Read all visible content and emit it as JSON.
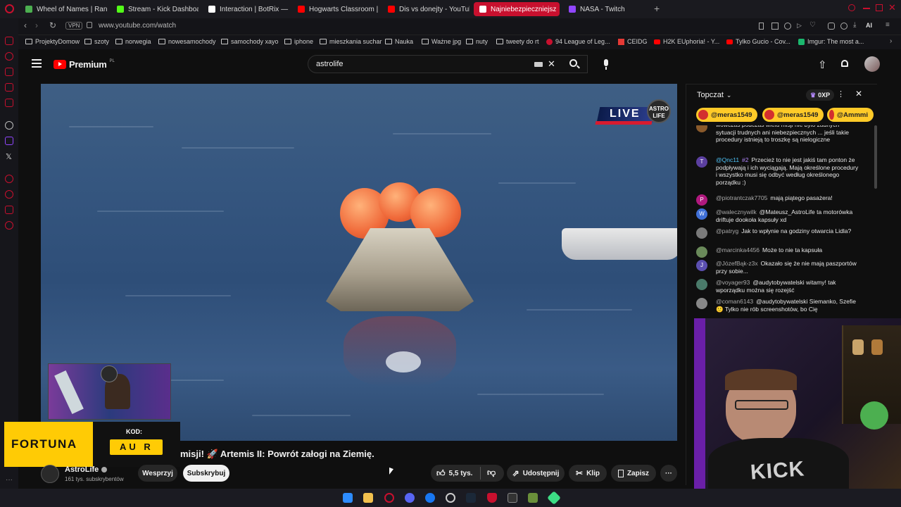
{
  "browser": {
    "tabs": [
      {
        "label": "Wheel of Names | Random",
        "color": "#4caf50",
        "active": false
      },
      {
        "label": "Stream - Kick Dashboard",
        "color": "#53fc18",
        "active": false
      },
      {
        "label": "Interaction | BotRix — Clo",
        "color": "#ffffff",
        "active": false
      },
      {
        "label": "Hogwarts Classroom | Ha",
        "color": "#ff0000",
        "active": false
      },
      {
        "label": "Dis vs donejty - YouTube",
        "color": "#ff0000",
        "active": false
      },
      {
        "label": "Najniebezpieczniejsz",
        "color": "#ffffff",
        "active": true
      },
      {
        "label": "NASA - Twitch",
        "color": "#9146ff",
        "active": false
      }
    ],
    "vpn_label": "VPN",
    "url": "www.youtube.com/watch",
    "ai_label": "AI",
    "bookmarks": [
      "ProjektyDomow",
      "szoty",
      "norwegia",
      "nowesamochody",
      "samochody xayo",
      "iphone",
      "mieszkania suchar",
      "Nauka",
      "Ważne jpg",
      "nuty",
      "tweety do rt",
      "94 League of Leg...",
      "CEIDG",
      "H2K EUphoria! - Y...",
      "Tylko Gucio - Cov...",
      "Imgur: The most a..."
    ]
  },
  "youtube": {
    "logo_label": "Premium",
    "logo_region": "PL",
    "search_value": "astrolife",
    "video": {
      "live_label": "LIVE",
      "channel_logo_text": "ASTRO LIFE",
      "title": "misji! 🚀 Artemis II: Powrót załogi na Ziemię."
    },
    "channel": {
      "name": "AstroLife",
      "subscribers": "161 tys. subskrybentów"
    },
    "actions": {
      "support": "Wesprzyj",
      "subscribe": "Subskrybuj",
      "likes": "5,5 tys.",
      "share": "Udostępnij",
      "clip": "Klip",
      "save": "Zapisz"
    },
    "overlay": {
      "sponsor": "FORTUNA",
      "code_label": "KOD:",
      "code_value": "AU R"
    }
  },
  "chat": {
    "mode_label": "Topczat",
    "xp_label": "0XP",
    "pinned": [
      "@meras1549",
      "@meras1549",
      "@Ammmi"
    ],
    "messages": [
      {
        "author": "",
        "text": "wówczas podczas wielu misji nie było żadnych sytuacji trudnych ani niebezpiecznych ... jeśli takie procedury istnieją to troszkę są nielogiczne",
        "avatar": "",
        "color": "#8a5a2b"
      },
      {
        "author": "@Qnc11",
        "badge": "#2",
        "text": "Przecież to nie jest jakiś tam ponton że podpływają i ich wyciągają. Mają określone procedury i wszystko musi się odbyć według określonego porządku :)",
        "avatar": "T",
        "color": "#5b3fa0"
      },
      {
        "author": "@piotrantczak7705",
        "text": "mają piątego pasażera!",
        "avatar": "P",
        "color": "#b0197e"
      },
      {
        "author": "@walecznywilk",
        "text": "@Mateusz_AstroLife ta motorówka driftuje dookoła kapsuły xd",
        "avatar": "W",
        "color": "#3f6fd6"
      },
      {
        "author": "@patryg",
        "text": "Jak to wpłynie na godziny otwarcia Lidla?",
        "avatar": "",
        "color": "#7a7a7a"
      },
      {
        "author": "@marcinka4456",
        "text": "Może to nie ta kapsuła",
        "avatar": "",
        "color": "#6a8a5a"
      },
      {
        "author": "@JózefBąk-z3x",
        "text": "Okazało się że nie mają paszportów przy sobie...",
        "avatar": "J",
        "color": "#5b4fb0"
      },
      {
        "author": "@voyager93",
        "text": "@audytobywatelski witamy! tak wporządku można się rozejść",
        "avatar": "",
        "color": "#4a7a6a"
      },
      {
        "author": "@coman6143",
        "text": "@audytobywatelski Siemanko, Szefie 🙂 Tylko nie rób screenshotów, bo Cię",
        "avatar": "",
        "color": "#888888"
      }
    ]
  },
  "streamer_cam": {
    "brand_text": "KICK"
  }
}
